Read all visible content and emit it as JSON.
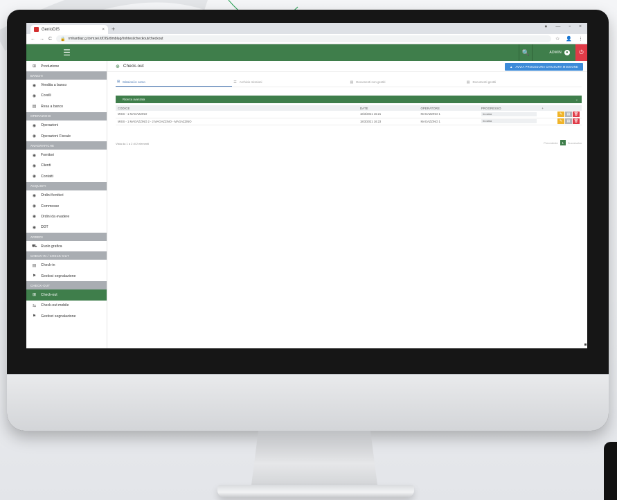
{
  "browser": {
    "tab_title": "GenioDIS",
    "tab_close": "×",
    "new_tab": "+",
    "url": "rmhardiaz.g.tormzei.it/DIS/dimblug/rinhtesi/checkout/checkout",
    "window_controls": [
      "●",
      "—",
      "▫",
      "×"
    ],
    "nav_back": "←",
    "nav_forward": "→",
    "nav_reload": "C"
  },
  "header": {
    "menu_icon": "☰",
    "search_icon": "🔍",
    "user_label": "ADMIN ",
    "user_avatar": "●",
    "logout_icon": "⏻"
  },
  "sidebar": {
    "items": [
      {
        "type": "item",
        "icon": "⊞",
        "label": "Produzione"
      },
      {
        "type": "section",
        "label": "BANCHI"
      },
      {
        "type": "item",
        "icon": "◉",
        "label": "Vendita a banco"
      },
      {
        "type": "item",
        "icon": "◉",
        "label": "Corelli"
      },
      {
        "type": "item",
        "icon": "▤",
        "label": "Resa a banco"
      },
      {
        "type": "section",
        "label": "OPERAZIONI"
      },
      {
        "type": "item",
        "icon": "◉",
        "label": "Operazioni"
      },
      {
        "type": "item",
        "icon": "◉",
        "label": "Operazioni Fiscale"
      },
      {
        "type": "section",
        "label": "ANAGRAFICHE"
      },
      {
        "type": "item",
        "icon": "◉",
        "label": "Fornitori"
      },
      {
        "type": "item",
        "icon": "◉",
        "label": "Clienti"
      },
      {
        "type": "item",
        "icon": "◉",
        "label": "Contatti"
      },
      {
        "type": "section",
        "label": "ACQUISTI"
      },
      {
        "type": "item",
        "icon": "◉",
        "label": "Ordini fornitori"
      },
      {
        "type": "item",
        "icon": "◉",
        "label": "Commesse"
      },
      {
        "type": "item",
        "icon": "◉",
        "label": "Ordini da evadere"
      },
      {
        "type": "item",
        "icon": "◉",
        "label": "DDT"
      },
      {
        "type": "section",
        "label": "ARREDI"
      },
      {
        "type": "item",
        "icon": "⛟",
        "label": "Ruolo grafica"
      },
      {
        "type": "section",
        "label": "CHECK-IN / CHECK-OUT"
      },
      {
        "type": "item",
        "icon": "▤",
        "label": "Check-in"
      },
      {
        "type": "item",
        "icon": "⚑",
        "label": "Gestisci segnalazione"
      },
      {
        "type": "section",
        "label": "CHECK-OUT"
      },
      {
        "type": "item",
        "icon": "⊞",
        "label": "Check-out",
        "active": true
      },
      {
        "type": "item",
        "icon": "⇆",
        "label": "Check-out mobile"
      },
      {
        "type": "item",
        "icon": "⚑",
        "label": "Gestisci segnalazione"
      }
    ]
  },
  "page": {
    "icon": "⊕",
    "title": "Check-out",
    "cta_icon": "▲",
    "cta_label": "AVVIA PROCEDURA CHIUSURA MISSIONE"
  },
  "tabs": [
    {
      "icon": "⊞",
      "label": "Missioni in corso",
      "active": true
    },
    {
      "icon": "☰",
      "label": "Archivio missioni"
    },
    {
      "icon": "▤",
      "label": "Documenti non gestiti"
    },
    {
      "icon": "▤",
      "label": "Documenti gestiti"
    }
  ],
  "filter": {
    "label": "Ricerca avanzata",
    "chevron": "⌄"
  },
  "table": {
    "columns": [
      "CODICE",
      "DATE",
      "OPERATORE",
      "PROGRESSO",
      "+"
    ],
    "rows": [
      {
        "code": "MISS - 1 MAGAZZINO",
        "date": "18/3/2021 15:21",
        "operator": "MAGAZZINO 1",
        "progress": "in corso"
      },
      {
        "code": "MISS - 1 MAGAZZINO 2 - 2 MAGAZZINO - MAGAZZINO",
        "date": "18/3/2021 16:23",
        "operator": "MAGAZZINO 1",
        "progress": "in corso"
      }
    ],
    "action_icons": {
      "edit": "✎",
      "view": "▤",
      "delete": "🗑"
    }
  },
  "footer": {
    "info": "Vista da 1 a 2 di 2 elementi",
    "prev": "Precedente",
    "page": "1",
    "next": "Successivo"
  },
  "colors": {
    "brand_green": "#3f7e4b",
    "accent_blue": "#3d8bd9",
    "danger_red": "#e03b48",
    "warning_yellow": "#f0b429"
  }
}
